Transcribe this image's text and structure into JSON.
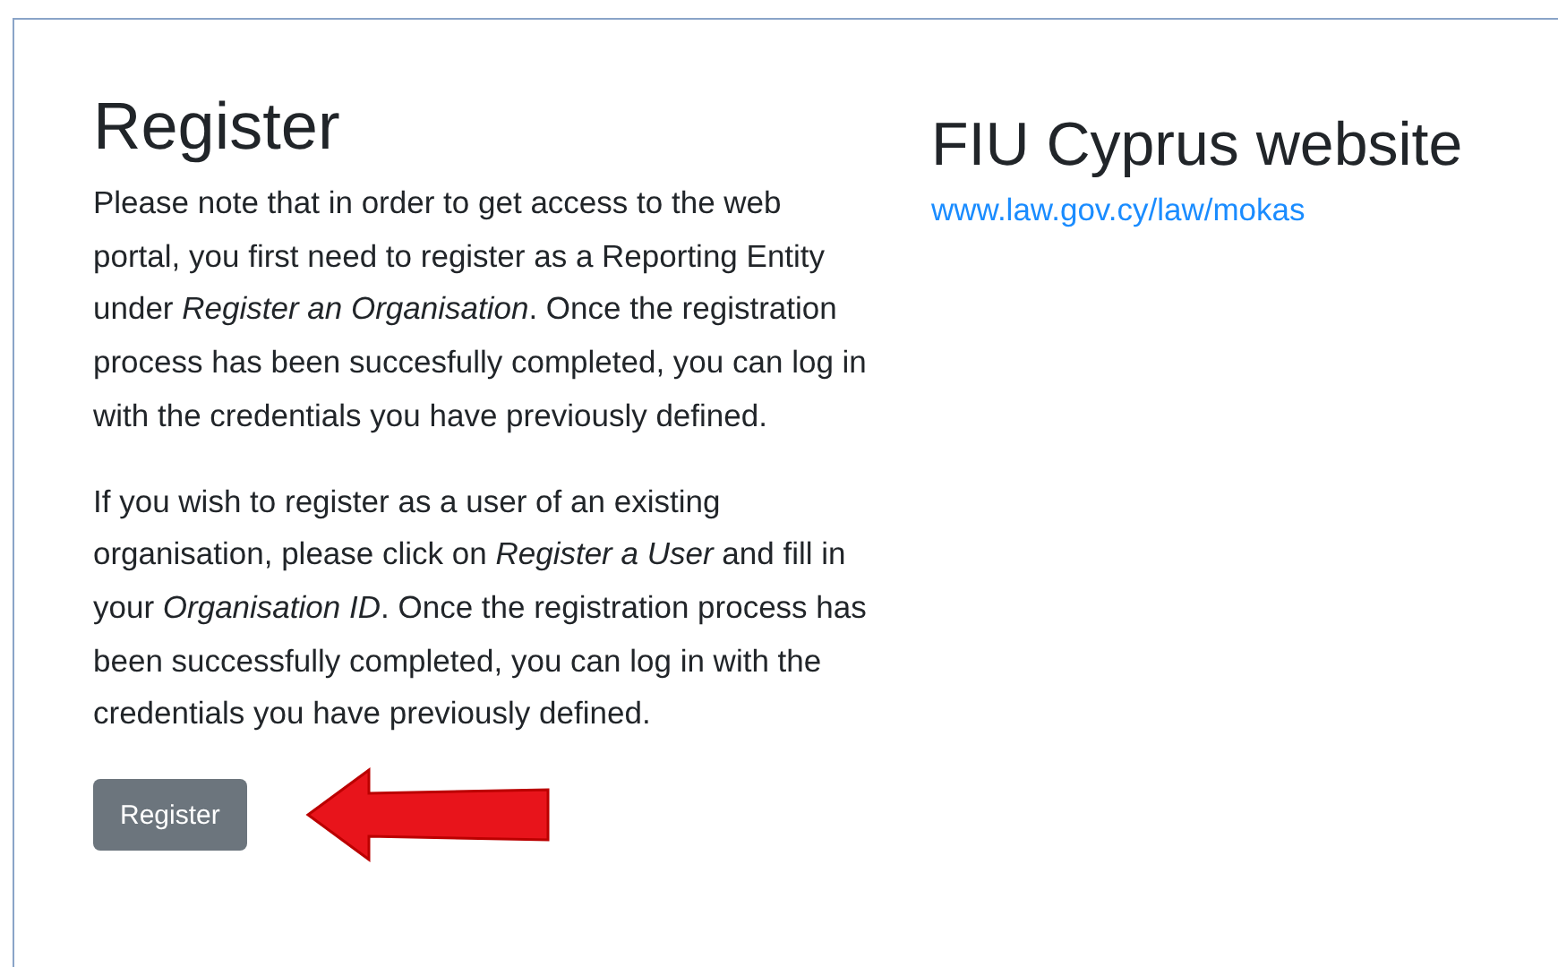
{
  "register": {
    "title": "Register",
    "paragraphs": [
      "Please note that in order to get access to the web portal, you first need to register as a Reporting Entity under *Register an Organisation*. Once the registration process has been succesfully completed, you can log in with the credentials you have previously defined.",
      "If you wish to register as a user of an existing organisation, please click on *Register a User* and fill in your *Organisation ID*. Once the registration process has been successfully completed, you can log in with the credentials you have previously defined."
    ],
    "button": "Register"
  },
  "website": {
    "title": "FIU Cyprus website",
    "link": "www.law.gov.cy/law/mokas"
  }
}
